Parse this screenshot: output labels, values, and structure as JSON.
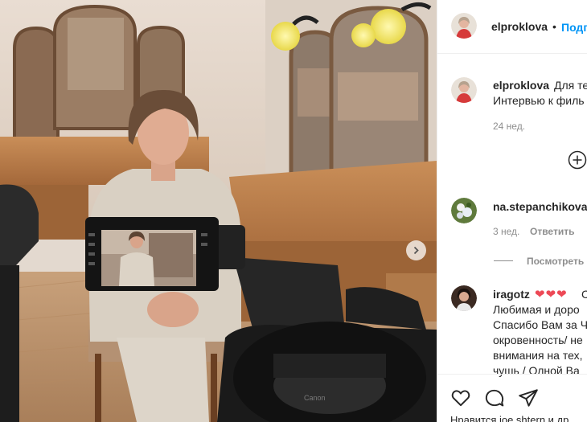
{
  "post": {
    "author": "elproklova",
    "header_dot": "•",
    "follow_label": "Подп",
    "caption_user": "elproklova",
    "caption_line1": "Для те",
    "caption_line2": "Интервью к филь",
    "caption_age": "24 нед."
  },
  "comments": [
    {
      "user": "na.stepanchikova",
      "age": "3 нед.",
      "reply_label": "Ответить",
      "view_replies": "Посмотреть о"
    },
    {
      "user": "iragotz",
      "hearts": "❤❤❤",
      "trail": "С",
      "lines": [
        "Любимая и доро",
        "Спасибо Вам за Ч",
        "окровенность/ не",
        "внимания на тех,",
        "чушь / Олной Ва"
      ]
    }
  ],
  "footer": {
    "liked_text": "Нравится joe.shtern и др"
  },
  "camera": {
    "brand": "Canon"
  },
  "icons": {
    "like": "heart-outline-icon",
    "comment": "comment-bubble-icon",
    "share": "paper-plane-icon",
    "add_comment": "plus-circle-icon",
    "next": "chevron-right-icon"
  },
  "colors": {
    "link": "#0095f6",
    "text": "#262626",
    "muted": "#8e8e8e",
    "heart": "#ed4956"
  }
}
